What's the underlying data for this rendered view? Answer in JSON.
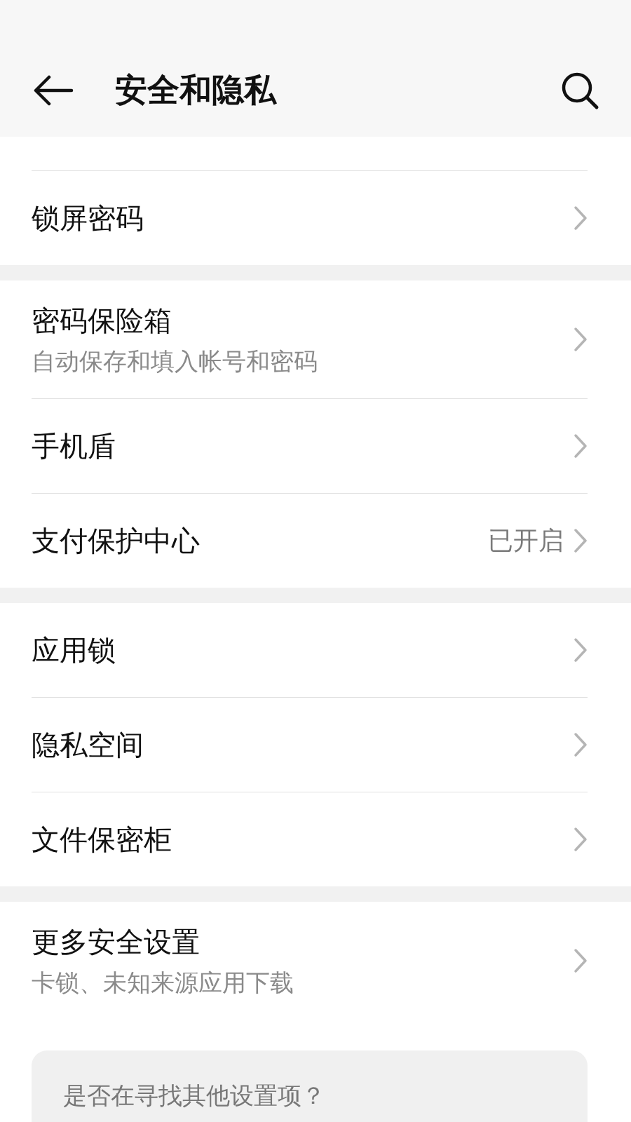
{
  "header": {
    "title": "安全和隐私"
  },
  "sections": [
    {
      "items": [
        {
          "title": "锁屏密码"
        }
      ]
    },
    {
      "items": [
        {
          "title": "密码保险箱",
          "subtitle": "自动保存和填入帐号和密码"
        },
        {
          "title": "手机盾"
        },
        {
          "title": "支付保护中心",
          "value": "已开启"
        }
      ]
    },
    {
      "items": [
        {
          "title": "应用锁"
        },
        {
          "title": "隐私空间"
        },
        {
          "title": "文件保密柜"
        }
      ]
    },
    {
      "items": [
        {
          "title": "更多安全设置",
          "subtitle": "卡锁、未知来源应用下载"
        }
      ]
    }
  ],
  "suggestion_card": {
    "text": "是否在寻找其他设置项？"
  }
}
